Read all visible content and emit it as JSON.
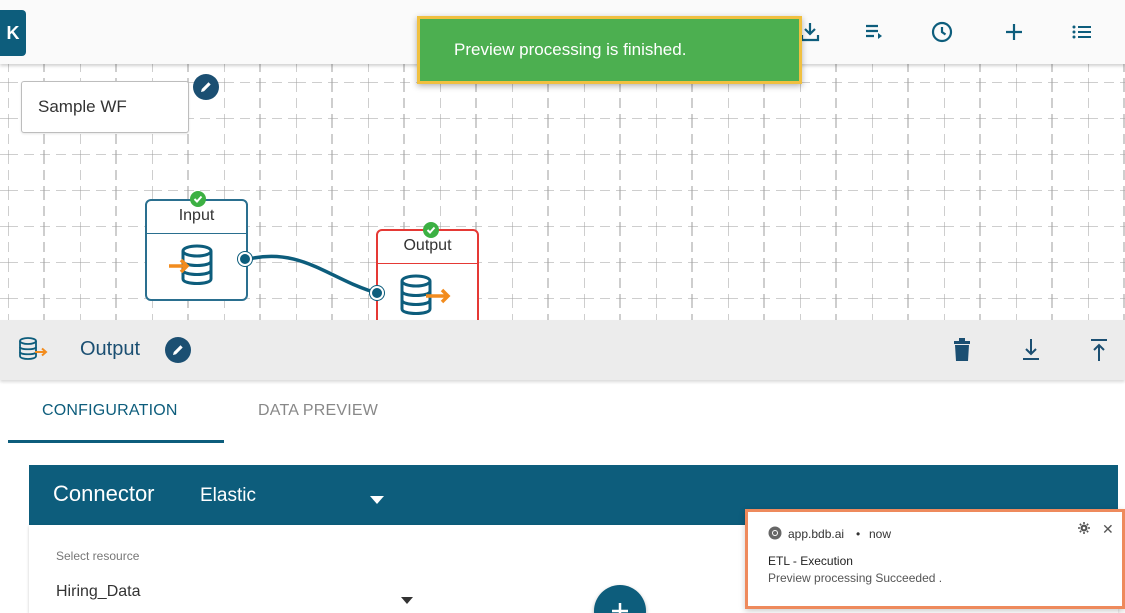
{
  "toolbar": {
    "collapse_label": "K"
  },
  "toast": {
    "message": "Preview processing is finished."
  },
  "workflow": {
    "name": "Sample WF"
  },
  "nodes": {
    "input_label": "Input",
    "output_label": "Output"
  },
  "panel": {
    "title": "Output",
    "tabs": [
      "CONFIGURATION",
      "DATA PREVIEW"
    ],
    "active_tab": "CONFIGURATION"
  },
  "connector": {
    "label": "Connector",
    "value": "Elastic"
  },
  "resource": {
    "label": "Select resource",
    "value": "Hiring_Data"
  },
  "notification": {
    "source": "app.bdb.ai",
    "time": "now",
    "separator": "•",
    "title": "ETL - Execution",
    "body": "Preview processing Succeeded ."
  },
  "colors": {
    "primary": "#0d5d7c",
    "toast_bg": "#4caf50",
    "toast_border": "#f0c040",
    "output_node_border": "#e53935",
    "notification_border": "#ee8a5c"
  }
}
